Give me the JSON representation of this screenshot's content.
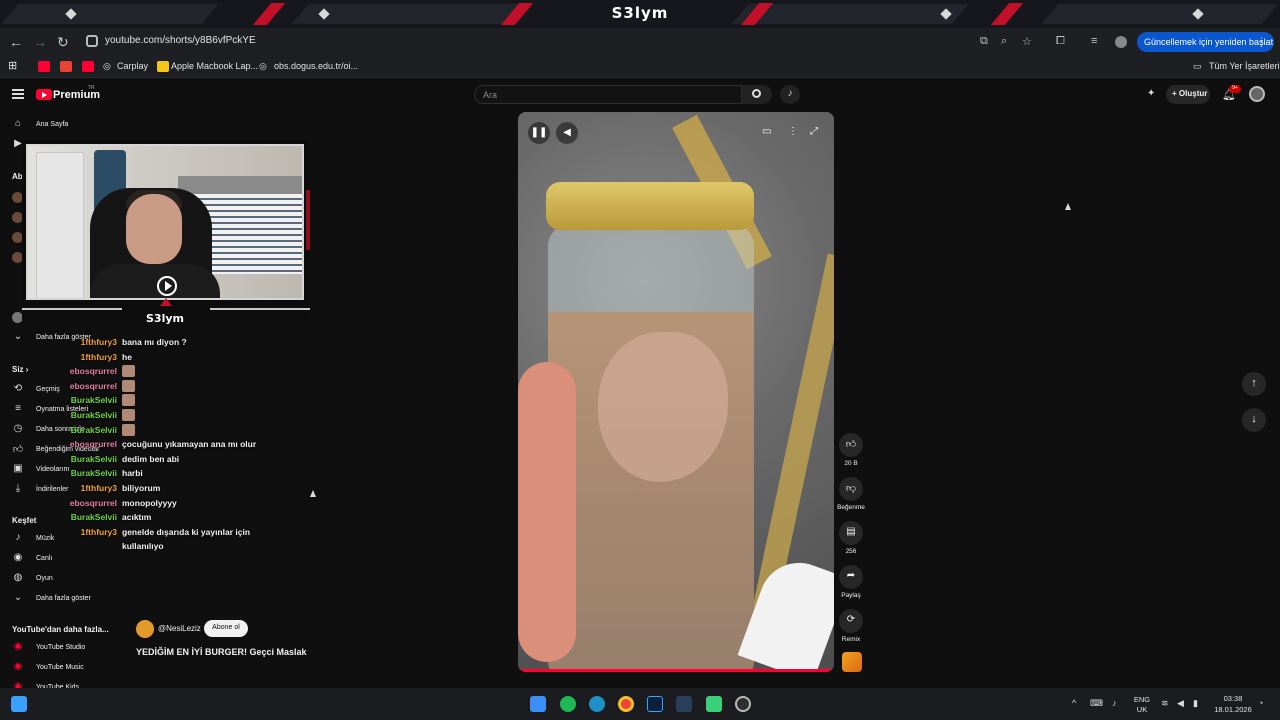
{
  "overlay": {
    "channel_logo": "S3lym",
    "cam_name": "S3lym"
  },
  "browser": {
    "url": "youtube.com/shorts/y8B6vfPckYE",
    "update_button": "Güncellemek için yeniden başlat",
    "bookmarks": [
      "Carplay",
      "Apple Macbook Lap...",
      "obs.dogus.edu.tr/oi..."
    ],
    "all_bookmarks": "Tüm Yer İşaretleri"
  },
  "youtube": {
    "brand": "Premium",
    "region": "TR",
    "search_placeholder": "Ara",
    "create_label": "Oluştur",
    "notif_count": "9+"
  },
  "sidebar": {
    "home": "Ana Sayfa",
    "subs_head_partial": "Abo",
    "show_more_1": "Daha fazla göster",
    "you_head": "Siz",
    "you_items": [
      "Geçmiş",
      "Oynatma listeleri",
      "Daha sonra izle",
      "Beğendiğim videolar",
      "Videolarım",
      "İndirilenler"
    ],
    "explore_head": "Keşfet",
    "explore_items": [
      "Müzik",
      "Canlı",
      "Oyun"
    ],
    "show_more_2": "Daha fazla göster",
    "more_head": "YouTube'dan daha fazla...",
    "more_items": [
      "YouTube Studio",
      "YouTube Music",
      "YouTube Kids"
    ]
  },
  "chat": [
    {
      "user": "1fthfury3",
      "color": "#f0a040",
      "msg": "bana mı diyon ?",
      "emote": false
    },
    {
      "user": "1fthfury3",
      "color": "#f0a040",
      "msg": "he",
      "emote": false
    },
    {
      "user": "ebosqrurrel",
      "color": "#e47fa0",
      "msg": "",
      "emote": true
    },
    {
      "user": "ebosqrurrel",
      "color": "#e47fa0",
      "msg": "",
      "emote": true
    },
    {
      "user": "BurakSelvii",
      "color": "#6fd14b",
      "msg": "",
      "emote": true
    },
    {
      "user": "BurakSelvii",
      "color": "#6fd14b",
      "msg": "",
      "emote": true
    },
    {
      "user": "BurakSelvii",
      "color": "#6fd14b",
      "msg": "",
      "emote": true
    },
    {
      "user": "ebosqrurrel",
      "color": "#e47fa0",
      "msg": "çocuğunu yıkamayan ana mı olur",
      "emote": false
    },
    {
      "user": "BurakSelvii",
      "color": "#6fd14b",
      "msg": "dedim ben abi",
      "emote": false
    },
    {
      "user": "BurakSelvii",
      "color": "#6fd14b",
      "msg": "harbi",
      "emote": false
    },
    {
      "user": "1fthfury3",
      "color": "#f0a040",
      "msg": "biliyorum",
      "emote": false
    },
    {
      "user": "ebosqrurrel",
      "color": "#e47fa0",
      "msg": "monopolyyyy",
      "emote": false
    },
    {
      "user": "BurakSelvii",
      "color": "#6fd14b",
      "msg": "acıktım",
      "emote": false
    },
    {
      "user": "1fthfury3",
      "color": "#f0a040",
      "msg": "genelde dışarıda ki yayınlar için",
      "emote": false
    },
    {
      "user": "",
      "color": "#f0a040",
      "msg": "kullanılıyo",
      "emote": false
    }
  ],
  "short": {
    "channel": "@NesiLeziz",
    "subscribe": "Abone ol",
    "title": "YEDİĞİM EN İYİ BURGER! Geçci Maslak"
  },
  "actions": {
    "like_count": "20 B",
    "dislike_label": "Beğenme",
    "comment_count": "256",
    "share_label": "Paylaş",
    "remix_label": "Remix"
  },
  "taskbar": {
    "lang_top": "ENG",
    "lang_bottom": "UK",
    "time": "03:38",
    "date": "18.01.2026"
  }
}
